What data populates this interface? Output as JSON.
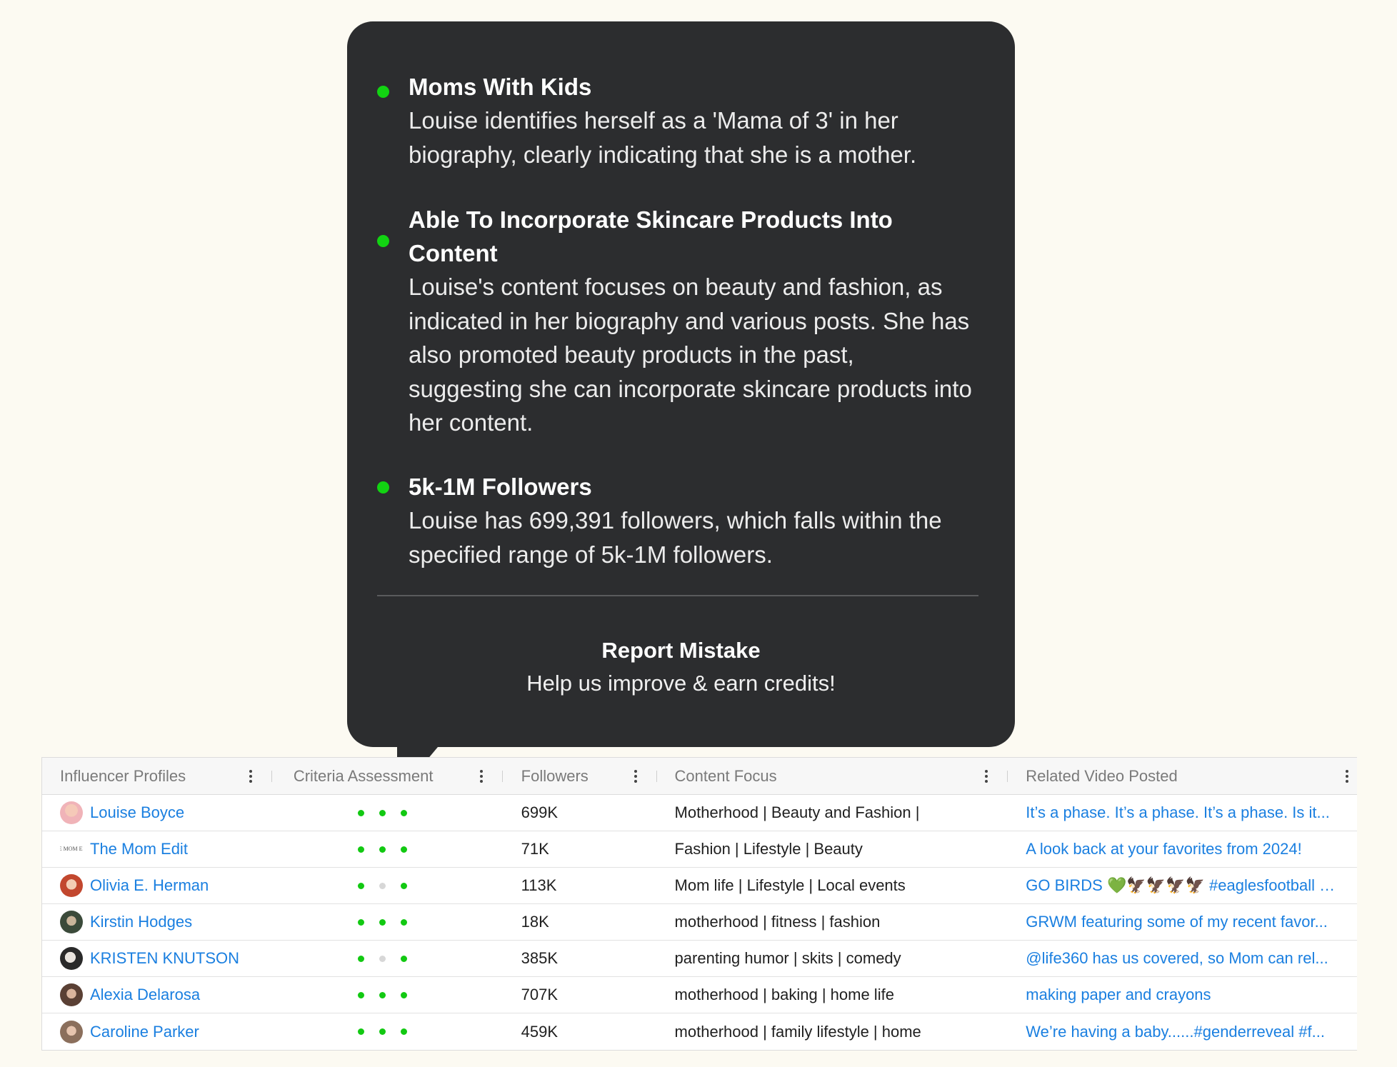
{
  "tooltip": {
    "criteria": [
      {
        "title": "Moms With Kids",
        "text": "Louise identifies herself as a 'Mama of 3' in her biography, clearly indicating that she is a mother.",
        "status_color": "#12d312"
      },
      {
        "title": "Able To Incorporate Skincare Products Into Content",
        "text": "Louise's content focuses on beauty and fashion, as indicated in her biography and various posts. She has also promoted beauty products in the past, suggesting she can incorporate skincare products into her content.",
        "status_color": "#12d312"
      },
      {
        "title": "5k-1M Followers",
        "text": "Louise has 699,391 followers, which falls within the specified range of 5k-1M followers.",
        "status_color": "#12d312"
      }
    ],
    "report_title": "Report Mistake",
    "report_subtitle": "Help us improve & earn credits!"
  },
  "table": {
    "columns": [
      "Influencer Profiles",
      "Criteria Assessment",
      "Followers",
      "Content Focus",
      "Related Video Posted"
    ],
    "rows": [
      {
        "name": "Louise Boyce",
        "avatar": "avatar-pink",
        "criteria": [
          true,
          true,
          true
        ],
        "followers": "699K",
        "focus": "Motherhood | Beauty and Fashion |",
        "video": "It’s a phase. It’s a phase. It’s a phase. Is it..."
      },
      {
        "name": "The Mom Edit",
        "avatar": "logo-text",
        "criteria": [
          true,
          true,
          true
        ],
        "followers": "71K",
        "focus": "Fashion | Lifestyle | Beauty",
        "video": "A look back at your favorites from 2024!"
      },
      {
        "name": "Olivia E. Herman",
        "avatar": "avatar-red",
        "criteria": [
          true,
          false,
          true
        ],
        "followers": "113K",
        "focus": "Mom life | Lifestyle | Local events",
        "video": "GO BIRDS 💚🦅🦅🦅🦅 #eaglesfootball #fl..."
      },
      {
        "name": "Kirstin Hodges",
        "avatar": "avatar-green",
        "criteria": [
          true,
          true,
          true
        ],
        "followers": "18K",
        "focus": "motherhood | fitness | fashion",
        "video": "GRWM featuring some of my recent favor..."
      },
      {
        "name": "KRISTEN KNUTSON",
        "avatar": "avatar-bw",
        "criteria": [
          true,
          false,
          true
        ],
        "followers": "385K",
        "focus": "parenting humor | skits | comedy",
        "video": "@life360 has us covered, so Mom can rel..."
      },
      {
        "name": "Alexia Delarosa",
        "avatar": "avatar-brown",
        "criteria": [
          true,
          true,
          true
        ],
        "followers": "707K",
        "focus": "motherhood | baking | home life",
        "video": "making paper and crayons"
      },
      {
        "name": "Caroline Parker",
        "avatar": "avatar-tan",
        "criteria": [
          true,
          true,
          true
        ],
        "followers": "459K",
        "focus": "motherhood | family lifestyle | home",
        "video": "We’re having a baby......#genderreveal #f..."
      }
    ]
  },
  "logo_text": "THE MOM EDIT",
  "colors": {
    "link": "#1a7fe0",
    "pass": "#12c912",
    "fail": "#d7d7d7",
    "tooltip_bg": "#2c2d2f"
  }
}
